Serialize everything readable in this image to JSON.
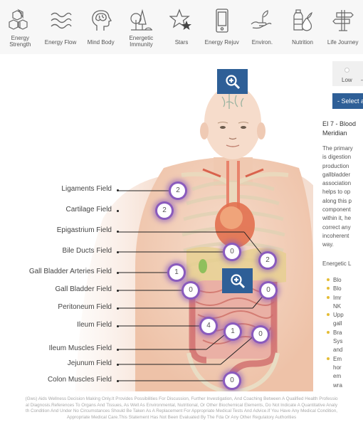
{
  "nav": {
    "items": [
      {
        "label": "Energy Strength",
        "line1": "Energy",
        "line2": "Strength",
        "icon": "hexagons-icon"
      },
      {
        "label": "Energy Flow",
        "icon": "waves-icon"
      },
      {
        "label": "Mind Body",
        "icon": "head-brain-icon"
      },
      {
        "label": "Energetic Immunity",
        "line1": "Energetic",
        "line2": "Immunity",
        "icon": "trees-icon"
      },
      {
        "label": "Stars",
        "icon": "stars-icon"
      },
      {
        "label": "Energy Rejuv",
        "icon": "phone-icon"
      },
      {
        "label": "Environ.",
        "icon": "hand-sprout-icon"
      },
      {
        "label": "Nutrition",
        "icon": "bottle-pear-icon"
      },
      {
        "label": "Life Journey",
        "icon": "signpost-icon"
      }
    ]
  },
  "diagram": {
    "fields": [
      {
        "label": "Ligaments Field",
        "value": "2"
      },
      {
        "label": "Cartilage Field",
        "value": "2"
      },
      {
        "label": "Epigastrium Field",
        "value": "2"
      },
      {
        "label": "Bile Ducts Field",
        "value": "0"
      },
      {
        "label": "Gall Bladder Arteries Field",
        "value": "1"
      },
      {
        "label": "Gall Bladder Field",
        "value": "0"
      },
      {
        "label": "Peritoneum Field",
        "value": "0"
      },
      {
        "label": "Ileum Field",
        "value": "4"
      },
      {
        "label": "Ileum Muscles Field",
        "value": "1"
      },
      {
        "label": "Jejunum Field",
        "value": "0"
      },
      {
        "label": "Colon Muscles Field",
        "value": "0"
      }
    ],
    "zoom_icon": "zoom-in-icon"
  },
  "panel": {
    "slider": {
      "low_label": "Low",
      "dash": "–"
    },
    "select_label": "- Select a",
    "meridian_title_1": "EI 7 - Blood",
    "meridian_title_2": "Meridian",
    "description_lines": [
      "The primary",
      "is digestion",
      "production",
      "gallbladder",
      "association",
      "helps to op",
      "along this p",
      "component",
      "within it, he",
      "correct any",
      "incoherent",
      "way."
    ],
    "energetic_links_label": "Energetic L",
    "links": [
      {
        "lines": [
          "Blo"
        ]
      },
      {
        "lines": [
          "Blo"
        ]
      },
      {
        "lines": [
          "Imr",
          "NK"
        ]
      },
      {
        "lines": [
          "Upp",
          "gall"
        ]
      },
      {
        "lines": [
          "Bra",
          "Sys",
          "and"
        ]
      },
      {
        "lines": [
          "Em",
          "hor",
          "em",
          "wra"
        ]
      }
    ]
  },
  "disclaimer": {
    "lines": [
      "(Gws) Aids Wellness Decision Making Only.It Provides Possibilities For Discussion, Further Investigation, And Coaching Between A Qualified Health Professio",
      "al Diagnosis.References To Organs And Tissues, As Well As Environmental, Nutritional, Or Other Biochemical Elements, Do Not Indicate A Quantitative Analy",
      "th Condition And Under No Circumstances Should Be Taken As A Replacement For Appropriate Medical Tests And Advice.If You Have Any Medical Condition,",
      "Appropriate Medical Care.This Statement Has Not Been Evaluated By The Fda Or Any Other Regulatory Authorities"
    ]
  },
  "colors": {
    "accent_blue": "#2e5f97",
    "badge_glow": "#8a5bbd",
    "bullet": "#e5bd36",
    "nav_bg": "#f7f7f7"
  }
}
